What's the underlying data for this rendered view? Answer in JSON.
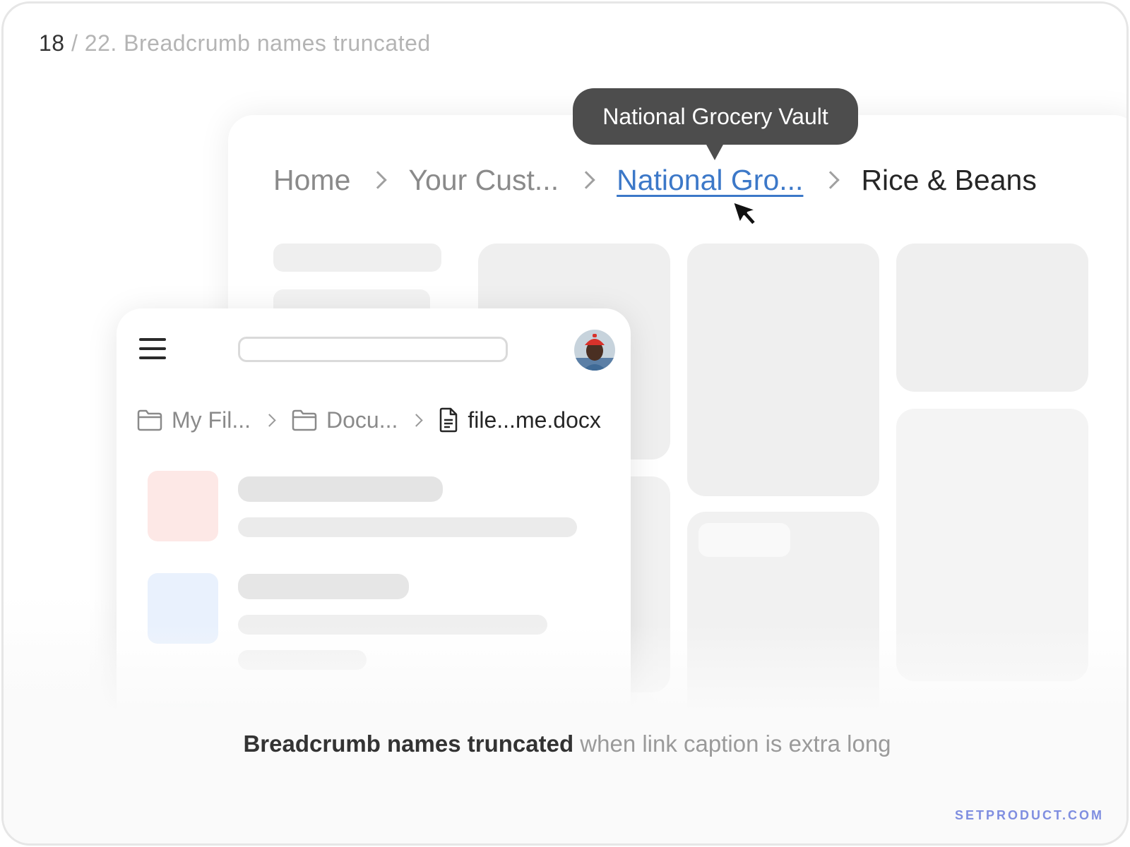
{
  "page": {
    "current": "18",
    "total_title": "/ 22. Breadcrumb names truncated"
  },
  "desktop": {
    "breadcrumb": [
      {
        "label": "Home"
      },
      {
        "label": "Your Cust..."
      },
      {
        "label": "National Gro..."
      },
      {
        "label": "Rice & Beans"
      }
    ],
    "tooltip": "National Grocery Vault"
  },
  "mobile": {
    "breadcrumb": [
      {
        "label": "My Fil...",
        "icon": "folder-icon"
      },
      {
        "label": "Docu...",
        "icon": "folder-icon"
      },
      {
        "label": "file...me.docx",
        "icon": "document-icon"
      }
    ],
    "search": {
      "placeholder": ""
    }
  },
  "caption": {
    "strong": "Breadcrumb names truncated",
    "rest": " when link caption is extra long"
  },
  "brand": "SETPRODUCT.COM",
  "colors": {
    "link": "#3c78c8",
    "tooltip_bg": "#4d4d4d",
    "brand": "#7f8ee0"
  }
}
